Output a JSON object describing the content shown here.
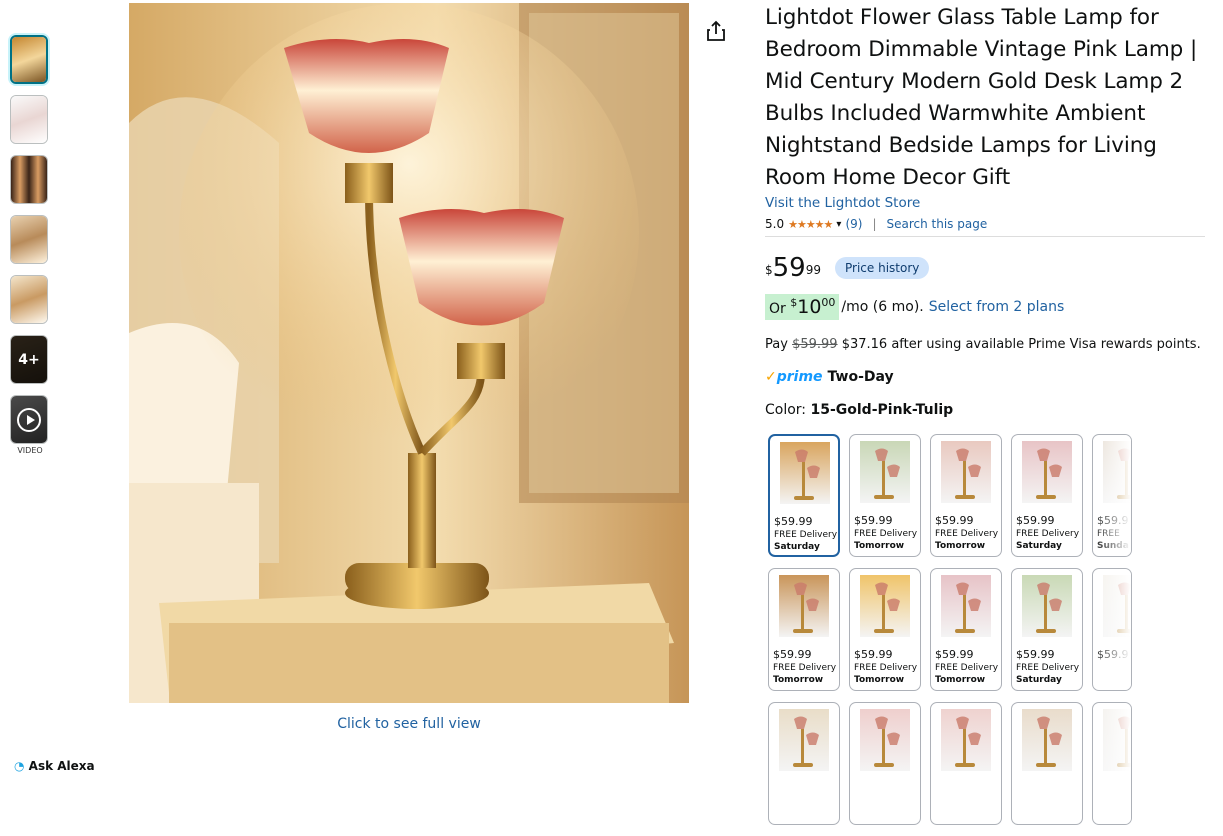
{
  "product": {
    "title": "Lightdot Flower Glass Table Lamp for Bedroom Dimmable Vintage Pink Lamp | Mid Century Modern Gold Desk Lamp 2 Bulbs Included Warmwhite Ambient Nightstand Bedside Lamps for Living Room Home Decor Gift",
    "store_link": "Visit the Lightdot Store",
    "rating": "5.0",
    "stars": "★★★★★",
    "review_count": "(9)",
    "search_page": "Search this page",
    "price_symbol": "$",
    "price_whole": "59",
    "price_fraction": "99",
    "price_history": "Price history",
    "monthly_or": "Or ",
    "monthly_symbol": "$",
    "monthly_whole": "10",
    "monthly_fraction": "00",
    "monthly_term": "/mo (6 mo).",
    "monthly_plans": "Select from 2 plans",
    "pay_prefix": "Pay ",
    "pay_strike": "$59.99",
    "pay_suffix": " $37.16 after using available Prime Visa rewards points.",
    "prime_check": "✓",
    "prime_label": "prime",
    "prime_delivery": "Two-Day",
    "color_label": "Color: ",
    "color_value": "15-Gold-Pink-Tulip"
  },
  "gallery": {
    "click_full": "Click to see full view",
    "more_count": "4+",
    "video_label": "VIDEO",
    "ask_alexa": "Ask Alexa"
  },
  "swatch_rows": [
    [
      {
        "price": "$59.99",
        "delivery": "FREE Delivery",
        "day": "Saturday",
        "tone": "#d9a55f",
        "selected": true
      },
      {
        "price": "$59.99",
        "delivery": "FREE Delivery",
        "day": "Tomorrow",
        "tone": "#c9d7b6"
      },
      {
        "price": "$59.99",
        "delivery": "FREE Delivery",
        "day": "Tomorrow",
        "tone": "#e9c9c0"
      },
      {
        "price": "$59.99",
        "delivery": "FREE Delivery",
        "day": "Saturday",
        "tone": "#e8c4c6"
      },
      {
        "price": "$59.9",
        "delivery": "FREE",
        "day": "Sunda",
        "tone": "#e6ddd2"
      }
    ],
    [
      {
        "price": "$59.99",
        "delivery": "FREE Delivery",
        "day": "Tomorrow",
        "tone": "#c9955a"
      },
      {
        "price": "$59.99",
        "delivery": "FREE Delivery",
        "day": "Tomorrow",
        "tone": "#f0c46a"
      },
      {
        "price": "$59.99",
        "delivery": "FREE Delivery",
        "day": "Tomorrow",
        "tone": "#e7c3c7"
      },
      {
        "price": "$59.99",
        "delivery": "FREE Delivery",
        "day": "Saturday",
        "tone": "#c9d9b5"
      },
      {
        "price": "$59.9",
        "delivery": "",
        "day": "",
        "tone": "#f3f0ea"
      }
    ],
    [
      {
        "price": "",
        "delivery": "",
        "day": "",
        "tone": "#e9ddc8"
      },
      {
        "price": "",
        "delivery": "",
        "day": "",
        "tone": "#efcfcd"
      },
      {
        "price": "",
        "delivery": "",
        "day": "",
        "tone": "#efd2cf"
      },
      {
        "price": "",
        "delivery": "",
        "day": "",
        "tone": "#e9dccb"
      },
      {
        "price": "",
        "delivery": "",
        "day": "",
        "tone": "#f1eee9"
      }
    ]
  ]
}
